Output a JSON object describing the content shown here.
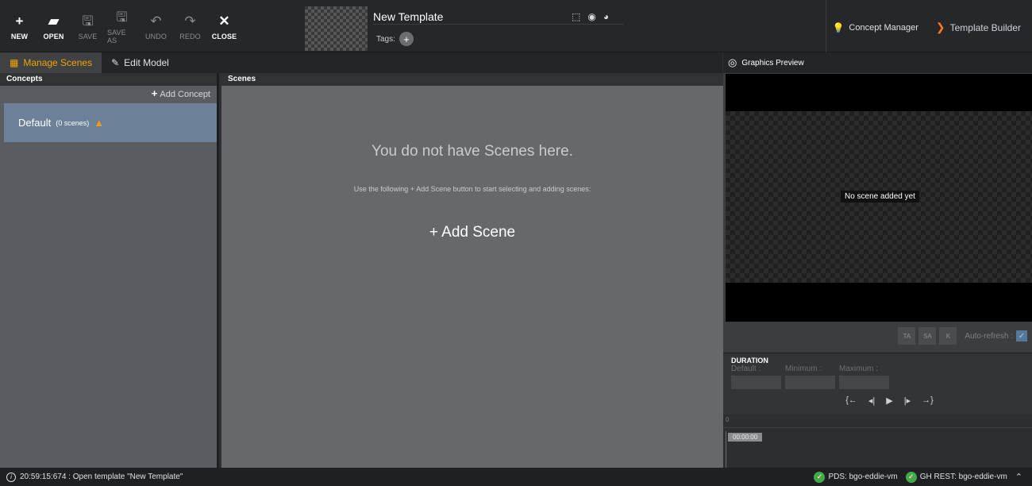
{
  "toolbar": {
    "buttons": [
      {
        "label": "NEW",
        "icon": "+",
        "disabled": false
      },
      {
        "label": "OPEN",
        "icon": "▰",
        "disabled": false
      },
      {
        "label": "SAVE",
        "icon": "🖫",
        "disabled": true
      },
      {
        "label": "SAVE AS",
        "icon": "🖫",
        "disabled": true
      },
      {
        "label": "UNDO",
        "icon": "↶",
        "disabled": true
      },
      {
        "label": "REDO",
        "icon": "↷",
        "disabled": true
      },
      {
        "label": "CLOSE",
        "icon": "✕",
        "disabled": false
      }
    ],
    "template_name": "New Template",
    "tags_label": "Tags:",
    "tag_add": "+",
    "concept_manager": "Concept Manager",
    "template_builder": "Template Builder"
  },
  "tabs": [
    {
      "label": "Manage Scenes",
      "active": true
    },
    {
      "label": "Edit Model",
      "active": false
    }
  ],
  "concepts": {
    "header": "Concepts",
    "add_label": "Add Concept",
    "items": [
      {
        "name": "Default",
        "count": "(0 scenes)",
        "warning": true
      }
    ]
  },
  "scenes": {
    "header": "Scenes",
    "empty_title": "You do not have Scenes here.",
    "empty_sub": "Use the following + Add Scene button to start selecting and adding scenes:",
    "add_label": "+ Add Scene"
  },
  "preview": {
    "title": "Graphics Preview",
    "no_scene": "No scene added yet",
    "btn_ta": "TA",
    "btn_sa": "SA",
    "btn_k": "K",
    "auto_refresh": "Auto-refresh :"
  },
  "duration": {
    "title": "DURATION",
    "default_label": "Default :",
    "minimum_label": "Minimum :",
    "maximum_label": "Maximum :"
  },
  "timeline": {
    "zero": "0",
    "time": "00:00:00"
  },
  "status": {
    "message": "20:59:15:674 : Open template \"New Template\"",
    "pds": "PDS: bgo-eddie-vm",
    "gh": "GH REST: bgo-eddie-vm"
  },
  "colors": {
    "accent": "#f0a500",
    "selected_concept": "#6c8198",
    "ok_green": "#47a84a",
    "warning": "#f09a1a"
  }
}
